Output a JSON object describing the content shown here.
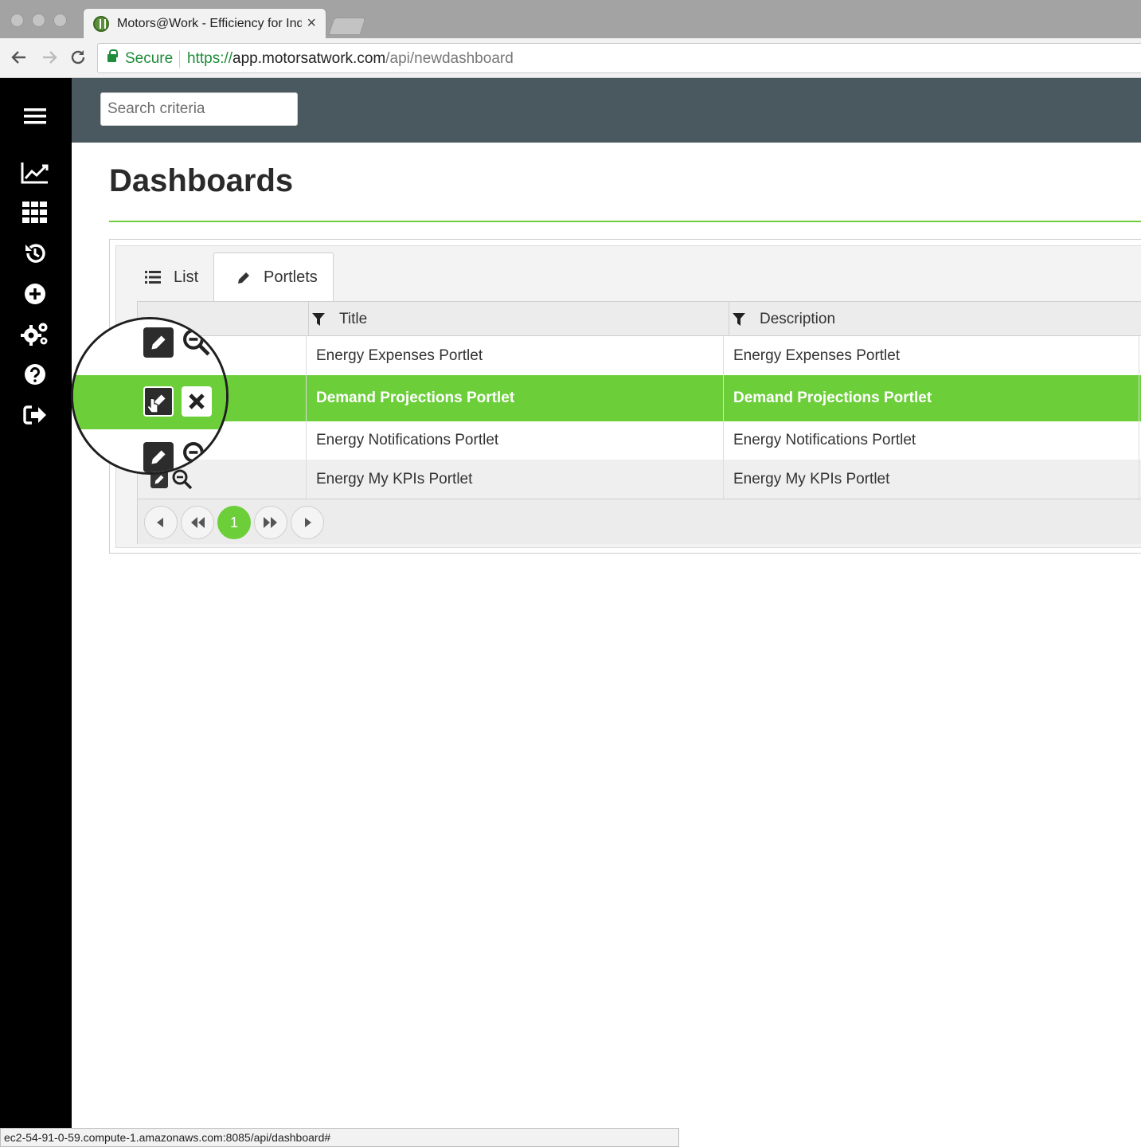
{
  "browser": {
    "tab_title": "Motors@Work - Efficiency for Industry",
    "tab_close": "×",
    "secure_label": "Secure",
    "url_scheme": "https://",
    "url_host": "app.motorsatwork.com",
    "url_path": "/api/newdashboard",
    "status_url": "ec2-54-91-0-59.compute-1.amazonaws.com:8085/api/dashboard#"
  },
  "sidebar": {
    "items": [
      {
        "icon": "menu-icon"
      },
      {
        "icon": "line-chart-icon"
      },
      {
        "icon": "grid-icon"
      },
      {
        "icon": "history-icon"
      },
      {
        "icon": "plus-circle-icon"
      },
      {
        "icon": "gears-icon"
      },
      {
        "icon": "help-icon"
      },
      {
        "icon": "logout-icon"
      }
    ]
  },
  "header": {
    "search_placeholder": "Search criteria"
  },
  "page": {
    "title": "Dashboards"
  },
  "tabs": [
    {
      "label": "List",
      "icon": "list-icon",
      "active": false
    },
    {
      "label": "Portlets",
      "icon": "pencil-icon",
      "active": true
    }
  ],
  "grid": {
    "columns": [
      "Title",
      "Description"
    ],
    "rows": [
      {
        "title": "Energy Expenses Portlet",
        "description": "Energy Expenses Portlet",
        "selected": false
      },
      {
        "title": "Demand Projections Portlet",
        "description": "Demand Projections Portlet",
        "selected": true
      },
      {
        "title": "Energy Notifications Portlet",
        "description": "Energy Notifications Portlet",
        "selected": false
      },
      {
        "title": "Energy My KPIs Portlet",
        "description": "Energy My KPIs Portlet",
        "selected": false
      }
    ]
  },
  "pager": {
    "current_page": "1"
  },
  "colors": {
    "accent": "#6ccf3a",
    "header_bg": "#4a5960",
    "sidebar_bg": "#000000"
  }
}
